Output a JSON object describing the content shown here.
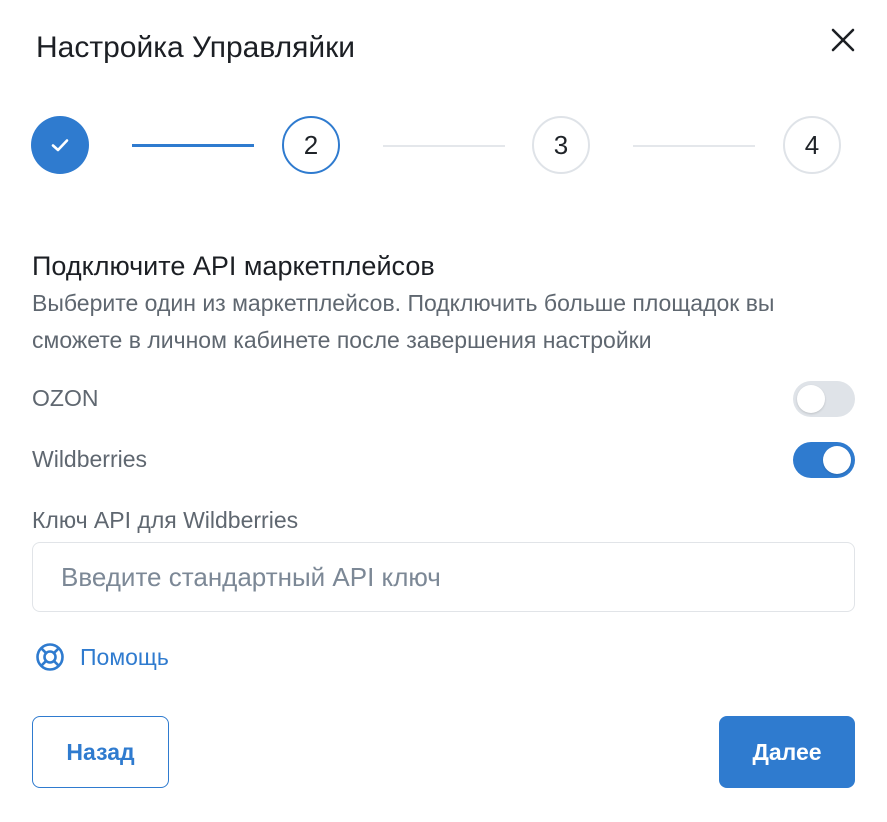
{
  "modal": {
    "title": "Настройка Управляйки",
    "close_icon": "close-icon"
  },
  "stepper": {
    "steps": [
      {
        "label": "",
        "state": "done",
        "icon": "check-icon"
      },
      {
        "label": "2",
        "state": "active"
      },
      {
        "label": "3",
        "state": "todo"
      },
      {
        "label": "4",
        "state": "todo"
      }
    ]
  },
  "section": {
    "title": "Подключите API маркетплейсов",
    "description": "Выберите один из маркетплейсов. Подключить больше площадок вы сможете в личном кабинете после завершения настройки"
  },
  "marketplaces": [
    {
      "label": "OZON",
      "enabled": false
    },
    {
      "label": "Wildberries",
      "enabled": true
    }
  ],
  "api_field": {
    "label": "Ключ API для Wildberries",
    "value": "",
    "placeholder": "Введите стандартный API ключ"
  },
  "help": {
    "label": "Помощь",
    "icon": "lifebuoy-icon"
  },
  "buttons": {
    "back_label": "Назад",
    "next_label": "Далее"
  },
  "colors": {
    "accent": "#2f7bcf",
    "text_primary": "#1c1f24",
    "text_secondary": "#5f6770",
    "border": "#e1e4e8",
    "toggle_off": "#dfe3e8"
  }
}
